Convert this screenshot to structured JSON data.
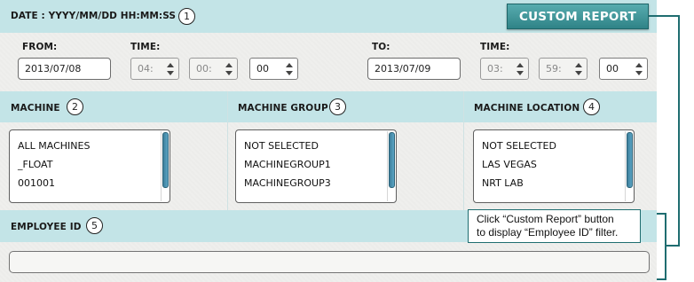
{
  "header": {
    "date_format_label": "DATE : YYYY/MM/DD HH:MM:SS",
    "callout_number": "1",
    "custom_report_button": "CUSTOM REPORT"
  },
  "date_range": {
    "from_label": "FROM:",
    "from_date": "2013/07/08",
    "from_time_label": "TIME:",
    "from_hour": "04:",
    "from_minute": "00:",
    "from_second": "00",
    "to_label": "TO:",
    "to_date": "2013/07/09",
    "to_time_label": "TIME:",
    "to_hour": "03:",
    "to_minute": "59:",
    "to_second": "00"
  },
  "machine": {
    "label": "MACHINE",
    "callout_number": "2",
    "items": [
      "ALL MACHINES",
      "_FLOAT",
      "001001"
    ]
  },
  "machine_group": {
    "label": "MACHINE GROUP",
    "callout_number": "3",
    "items": [
      "NOT SELECTED",
      "MACHINEGROUP1",
      "MACHINEGROUP3"
    ]
  },
  "machine_location": {
    "label": "MACHINE LOCATION",
    "callout_number": "4",
    "items": [
      "NOT SELECTED",
      "LAS VEGAS",
      "NRT LAB"
    ]
  },
  "employee": {
    "label": "EMPLOYEE ID",
    "callout_number": "5",
    "value": ""
  },
  "tooltip": {
    "line1": "Click “Custom Report” button",
    "line2": "to display “Employee ID” filter."
  },
  "colors": {
    "band": "#c3e4e7",
    "panel": "#efefed",
    "button": "#3c8f93",
    "scroll_thumb": "#4a92b2",
    "callout_line": "#1f6d70"
  }
}
